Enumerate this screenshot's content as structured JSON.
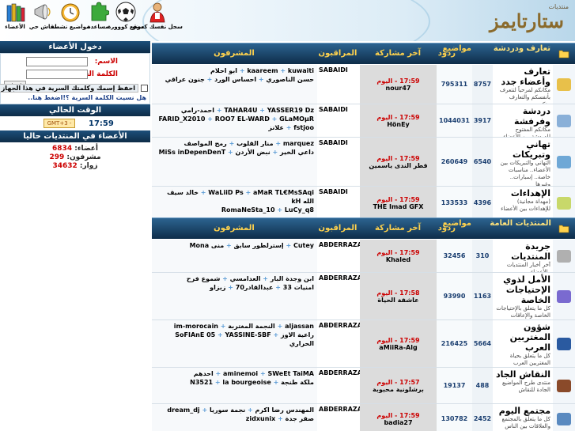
{
  "logo": {
    "small": "منتديات",
    "big": "ستارتايمز"
  },
  "nav": [
    {
      "label": "سجل نفسك كعضو",
      "icon": "person-icon"
    },
    {
      "label": "موقع كووورة",
      "icon": "soccer-ball-icon"
    },
    {
      "label": "مساعدة",
      "icon": "puzzle-help-icon"
    },
    {
      "label": "مواضيع نشطة",
      "icon": "clock-icon"
    },
    {
      "label": "نقاش حي",
      "icon": "megaphone-icon"
    },
    {
      "label": "الأعضاء",
      "icon": "books-icon"
    }
  ],
  "sidebar": {
    "login_title": "دخول الأعضاء",
    "username_label": "الاسم:",
    "password_label": "الكلمة السرية:",
    "login_button": "ادخل",
    "forgot_password": "هل نسيت الكلمة السرية ؟!اضغط هنا..",
    "remember_text": "احفظ إسمك وكلمتك السرية في هذا الجهاز",
    "time_title": "الوقت الحالي",
    "time_value": "17:59",
    "timezone": "GMT+3 -",
    "online_title": "الأعضاء في المنتديات حاليا",
    "members_label": "أعضاء:",
    "members_count": "6834",
    "supervisors_label": "مشرفون:",
    "supervisors_count": "299",
    "visitors_label": "زوار:",
    "visitors_count": "34632"
  },
  "headers": [
    {
      "forum": "تعارف ودردشة",
      "posts": "مواضيع",
      "threads": "ردود",
      "last": "آخر مشاركة",
      "mods": "المراقبون",
      "sup": "المشرفون"
    },
    {
      "forum": "المنتديات العامة",
      "posts": "مواضيع",
      "threads": "ردود",
      "last": "آخر مشاركة",
      "mods": "المراقبون",
      "sup": "المشرفون"
    }
  ],
  "forums_section1": [
    {
      "title": "تعارف وأعضاء جدد",
      "desc": "مكانكم لمرحباً لتتعرف بأنفسكم والتعارف بينكم..",
      "topics": "8757",
      "replies": "795311",
      "time": "17:59 - اليوم",
      "by": "nour47",
      "mods": "SABAIDI",
      "sup": [
        "kaareem",
        "kuwaiti",
        "ابو احلام",
        "حسن الناصوري",
        "احساس الورد",
        "جنون عراقي"
      ]
    },
    {
      "title": "دردشة وفرفشة",
      "desc": "مكانكم المفتوح للدردشة بين الأعضاء",
      "topics": "3917",
      "replies": "1044031",
      "time": "17:59 - اليوم",
      "by": "HönEy",
      "mods": "SABAIDI",
      "sup": [
        "TAHAR4U",
        "YASSER19 Dz",
        "احمد-رامي",
        "FARID_X2010",
        "ROO7 EL-WARD",
        "GLaMOµR",
        "fstjoo",
        "علانز"
      ]
    },
    {
      "title": "تهاني وتبريكات",
      "desc": "التهاني والتبريكات بين الأعضاء.. مناسبات خاصة.. إسبارات.. وغيرها",
      "topics": "6540",
      "replies": "260649",
      "time": "17:59 - اليوم",
      "by": "قطر الندى ياسمين",
      "mods": "SABAIDI",
      "sup": [
        "marquez",
        "منار القلوب",
        "رمح المواصف",
        "داعي الخير",
        "نبض الأردن",
        "MiSs inDepenDenT"
      ]
    },
    {
      "title": "الإهداءات",
      "desc": "(مهداة مجانية) للإهداءات بين الأعضاء",
      "topics": "4396",
      "replies": "133533",
      "time": "17:59 - اليوم",
      "by": "THE Imad GFX",
      "mods": "SABAIDI",
      "sup": [
        "WaLiiD Ps",
        "aMaR TL€MsSAqi",
        "خالد سيف الله kH",
        "RomaNeSta_10",
        "LuCy_q8"
      ]
    }
  ],
  "forums_section2": [
    {
      "title": "جريدة المنتديات",
      "desc": "آخر أخبار المنتديات والأعضاء",
      "topics": "310",
      "replies": "32456",
      "time": "17:59 - اليوم",
      "by": "Khaled",
      "mods": "ABDERRAZAK",
      "sup": [
        "Cutey",
        "إسترلطور سابق",
        "منى Mona"
      ]
    },
    {
      "title": "الأمل لذوي الإحتياجات الخاصة",
      "desc": "كل ما يتعلق بالإحتياجات الخاصة والإعاقات",
      "topics": "1163",
      "replies": "93990",
      "time": "17:58 - اليوم",
      "by": "عاشقة الحياة",
      "mods": "ABDERRAZAK",
      "sup": [
        "ابن وجدة البار",
        "العدامسي",
        "شموع فرح",
        "امنيات 33",
        "عبدالقادر70",
        "زبزاو"
      ]
    },
    {
      "title": "شؤون المغتربين العرب",
      "desc": "كل ما يتعلق بحياة المغتربين العرب",
      "topics": "5664",
      "replies": "216425",
      "time": "17:59 - اليوم",
      "by": "aMiiRa-Alg",
      "mods": "ABDERRAZAK",
      "sup": [
        "aljassan",
        "النجمة المغتربة",
        "im-morocain",
        "راعية الاوز",
        "SoFIAnE 05",
        "YASSINE-SBF",
        "الحراري"
      ]
    },
    {
      "title": "النقاش الجاد",
      "desc": "منتدى طرح المواضيع الجادة للنقاش",
      "topics": "488",
      "replies": "19137",
      "time": "17:57 - اليوم",
      "by": "برشلونية محبوبة",
      "mods": "ABDERRAZAK",
      "sup": [
        "aminemoi",
        "SWeEt TaiMA",
        "احدهم",
        "ملكة طنجة",
        "N3521",
        "la bourgeoise"
      ]
    },
    {
      "title": "مجتمع اليوم",
      "desc": "كل ما يتعلق بالمجتمع والعلاقات بين الناس",
      "topics": "2452",
      "replies": "130782",
      "time": "17:59 - اليوم",
      "by": "badia27",
      "mods": "ABDERRAZAK",
      "sup": [
        "المهندس رضا اكرم",
        "نجمة سوريا",
        "dream_dj",
        "صقر جدة",
        "zidxunix"
      ]
    }
  ]
}
